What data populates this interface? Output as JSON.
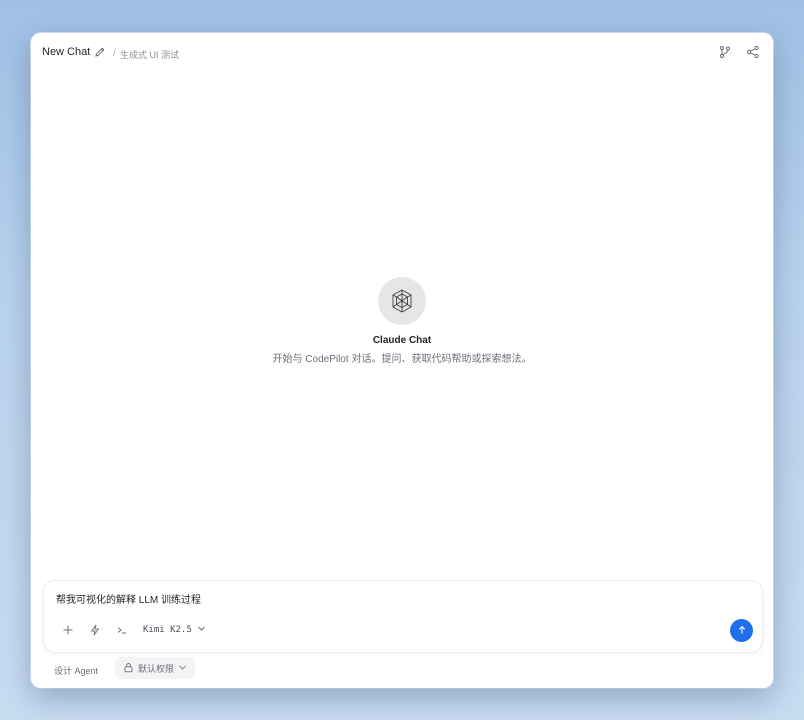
{
  "header": {
    "title": "New Chat",
    "separator": "/",
    "project": "生成式 UI 测试",
    "icons": [
      "edit-icon",
      "git-branch-icon",
      "share-icon"
    ]
  },
  "empty_state": {
    "logo_icon": "cube-network-icon",
    "title": "Claude Chat",
    "subtitle": "开始与 CodePilot 对话。提问、获取代码帮助或探索想法。"
  },
  "composer": {
    "input_value": "帮我可视化的解释 LLM 训练过程",
    "tools": [
      "plus-icon",
      "bolt-icon",
      "terminal-icon"
    ],
    "model": "Kimi K2.5",
    "send_icon": "arrow-up-icon",
    "accent": "#1f6feb"
  },
  "footer": {
    "mode": "设计 Agent",
    "permission": "默认权限"
  }
}
